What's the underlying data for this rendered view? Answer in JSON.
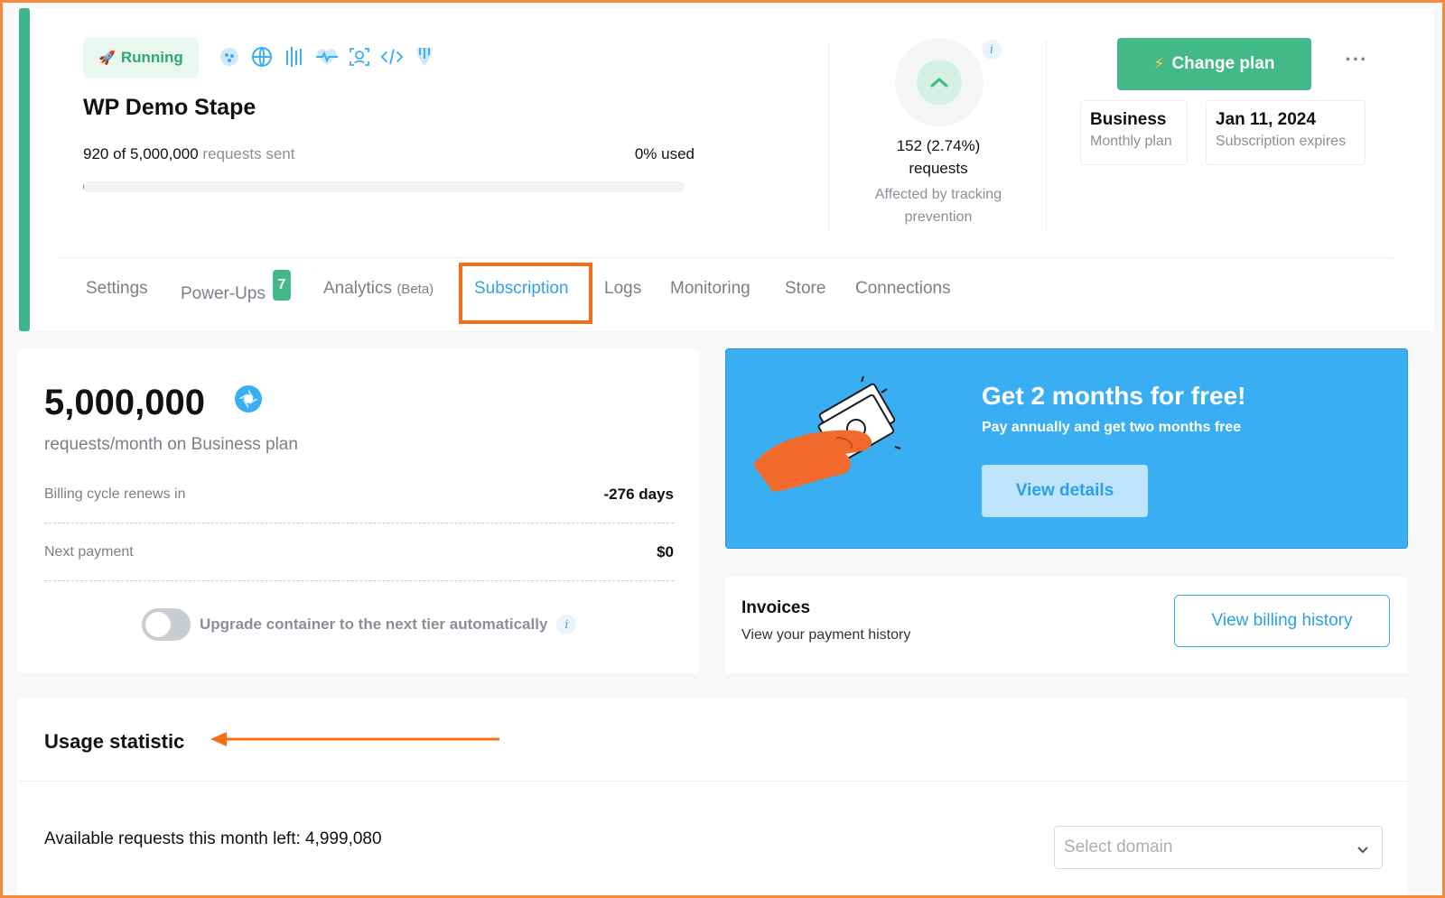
{
  "header": {
    "status_label": "Running",
    "status_icon": "rocket-icon",
    "container_icons": [
      "cluster-icon",
      "globe-icon",
      "barcode-icon",
      "heart-pulse-icon",
      "face-scan-icon",
      "code-icon",
      "plugin-icon"
    ],
    "container_name": "WP Demo Stape",
    "requests_used": "920",
    "requests_of": "of",
    "requests_total": "5,000,000",
    "requests_sent_label": "requests sent",
    "used_percent": "0% used",
    "usage_fraction": 0.0002
  },
  "tracking_prevention": {
    "value": "152 (2.74%)",
    "unit": "requests",
    "caption": "Affected by tracking prevention",
    "info": "i"
  },
  "plan": {
    "change_plan_label": "Change plan",
    "change_plan_icon": "lightning-icon",
    "more_label": "···",
    "plan_name": "Business",
    "plan_period": "Monthly plan",
    "expires_date": "Jan 11, 2024",
    "expires_label": "Subscription expires"
  },
  "tabs": [
    {
      "label": "Settings"
    },
    {
      "label": "Power-Ups",
      "badge": "7"
    },
    {
      "label": "Analytics",
      "suffix": "(Beta)"
    },
    {
      "label": "Subscription",
      "active": true
    },
    {
      "label": "Logs"
    },
    {
      "label": "Monitoring"
    },
    {
      "label": "Store"
    },
    {
      "label": "Connections"
    }
  ],
  "subscription": {
    "amount": "5,000,000",
    "caption": "requests/month on Business plan",
    "billing_label": "Billing cycle renews in",
    "billing_value": "-276 days",
    "next_payment_label": "Next payment",
    "next_payment_value": "$0",
    "auto_upgrade_label": "Upgrade container to the next tier automatically",
    "auto_upgrade_on": false,
    "info": "i"
  },
  "promo": {
    "title": "Get 2 months for free!",
    "subtitle": "Pay annually and get two months free",
    "button": "View details"
  },
  "invoices": {
    "title": "Invoices",
    "subtitle": "View your payment history",
    "button": "View billing history"
  },
  "usage": {
    "title": "Usage statistic",
    "available_label": "Available requests this month left: 4,999,080",
    "select_placeholder": "Select domain"
  },
  "colors": {
    "accent_green": "#43b888",
    "accent_blue": "#3aaef3",
    "highlight_orange": "#f56f1b"
  }
}
